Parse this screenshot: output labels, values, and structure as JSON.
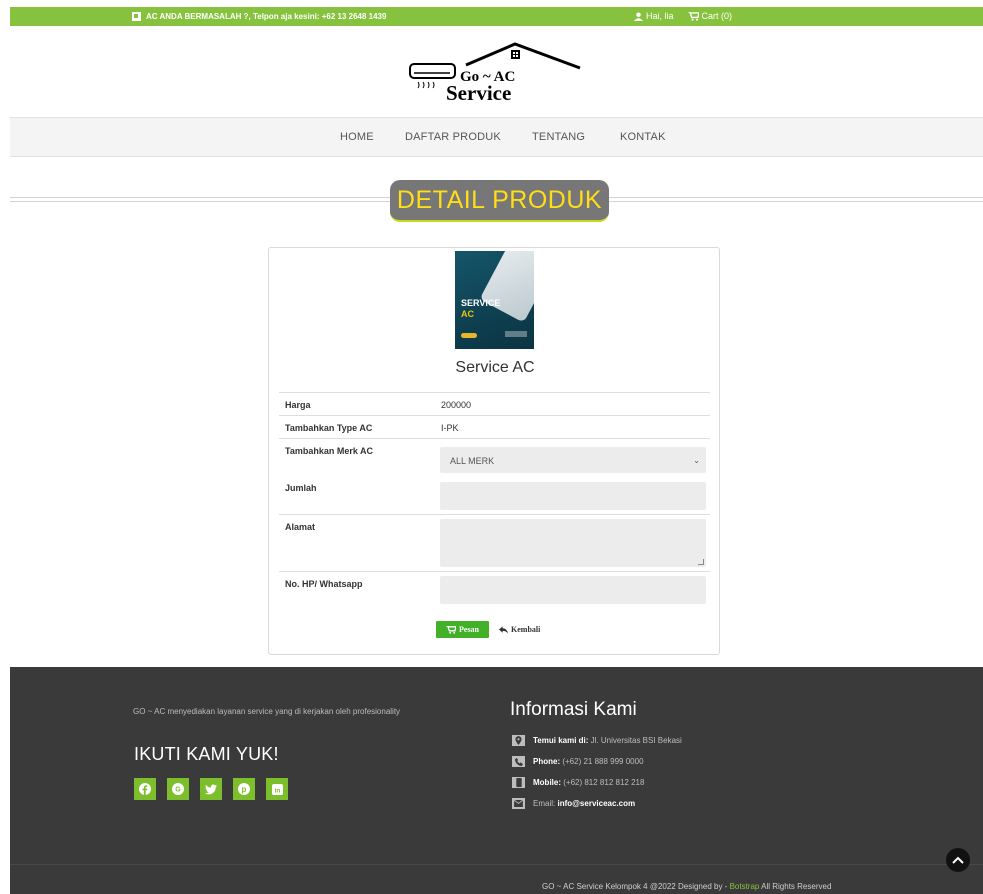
{
  "topbar": {
    "notice": "AC ANDA BERMASALAH ?, Telpon aja kesini: +62 13 2648 1439",
    "user": "Hai, lia",
    "cart": "Cart (0)"
  },
  "logo": {
    "line1": "Go ~ AC",
    "line2": "Service"
  },
  "nav": {
    "items": [
      "HOME",
      "DAFTAR PRODUK",
      "TENTANG",
      "KONTAK"
    ]
  },
  "page_title": "DETAIL PRODUK",
  "product": {
    "image_text_1": "SERVICE",
    "image_text_2": "AC",
    "name": "Service AC",
    "rows": {
      "harga_label": "Harga",
      "harga_value": "200000",
      "type_label": "Tambahkan Type AC",
      "type_value": "I-PK",
      "merk_label": "Tambahkan Merk AC",
      "merk_selected": "ALL MERK",
      "jumlah_label": "Jumlah",
      "alamat_label": "Alamat",
      "hp_label": "No. HP/ Whatsapp"
    },
    "buttons": {
      "pesan": "Pesan",
      "kembali": "Kembali"
    }
  },
  "footer": {
    "about": "GO ~ AC menyediakan layanan service yang di kerjakan oleh profesionality",
    "follow_title": "IKUTI KAMI YUK!",
    "social_icons": [
      "facebook-icon",
      "google-plus-icon",
      "twitter-icon",
      "pinterest-icon",
      "linkedin-icon"
    ],
    "info_title": "Informasi Kami",
    "info": {
      "address_label": "Temui kami di:",
      "address_value": "Jl. Universitas BSI Bekasi",
      "phone_label": "Phone:",
      "phone_value": "(+62) 21 888 999 0000",
      "mobile_label": "Mobile:",
      "mobile_value": "(+62) 812 812 812 218",
      "email_label": "Email:",
      "email_value": "info@serviceac.com"
    },
    "copyright_pre": "GO ~ AC Service Kelompok 4 @2022 Designed by -",
    "copyright_link": "Botstrap",
    "copyright_post": "All Rights Reserved"
  },
  "colors": {
    "brand_green": "#86c23e",
    "title_yellow": "#ffde17",
    "footer_bg": "#3a3a3a"
  }
}
